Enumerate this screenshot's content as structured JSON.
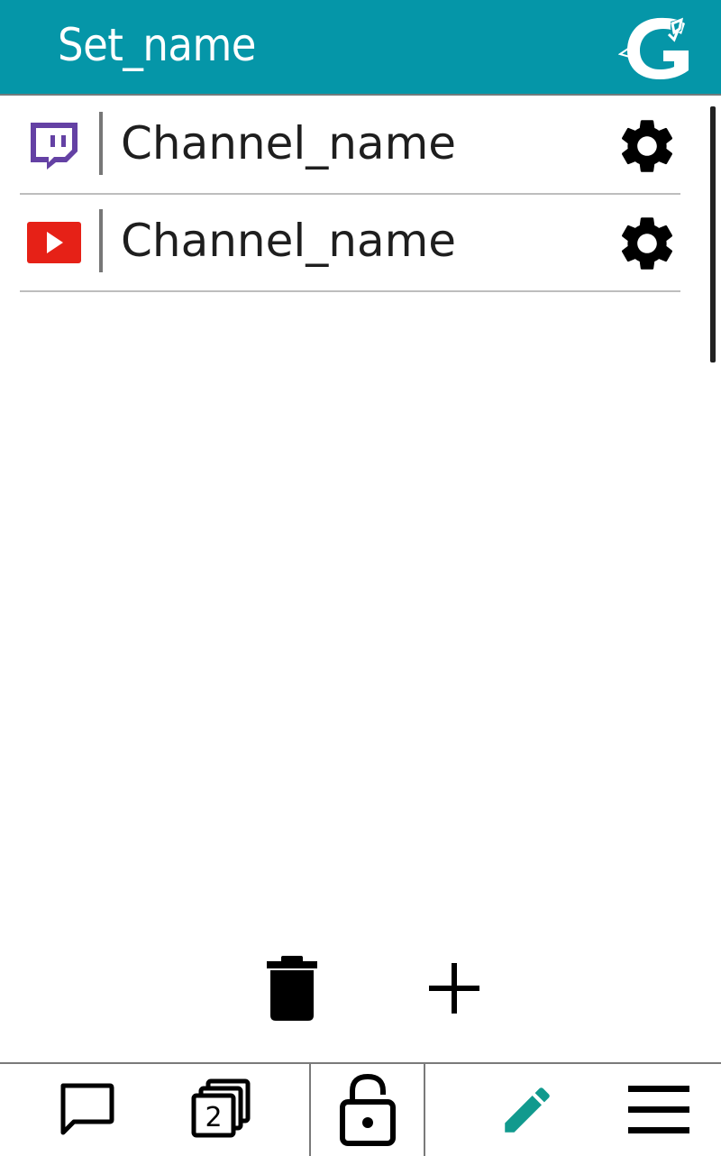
{
  "header": {
    "title": "Set_name",
    "logo_icon": "app-logo-g-icon"
  },
  "channels": [
    {
      "platform": "twitch",
      "icon": "twitch-icon",
      "name": "Channel_name",
      "settings_icon": "gear-icon"
    },
    {
      "platform": "youtube",
      "icon": "youtube-icon",
      "name": "Channel_name",
      "settings_icon": "gear-icon"
    }
  ],
  "actions": {
    "delete_icon": "trash-icon",
    "add_icon": "plus-icon"
  },
  "bottom_nav": {
    "chat_icon": "chat-bubble-icon",
    "windows_icon": "stacked-windows-icon",
    "windows_count": "2",
    "lock_icon": "unlock-icon",
    "edit_icon": "pencil-icon",
    "menu_icon": "hamburger-menu-icon"
  },
  "colors": {
    "header_bg": "#0596a8",
    "twitch": "#6441a4",
    "youtube": "#e62117",
    "edit_active": "#119a8e"
  }
}
